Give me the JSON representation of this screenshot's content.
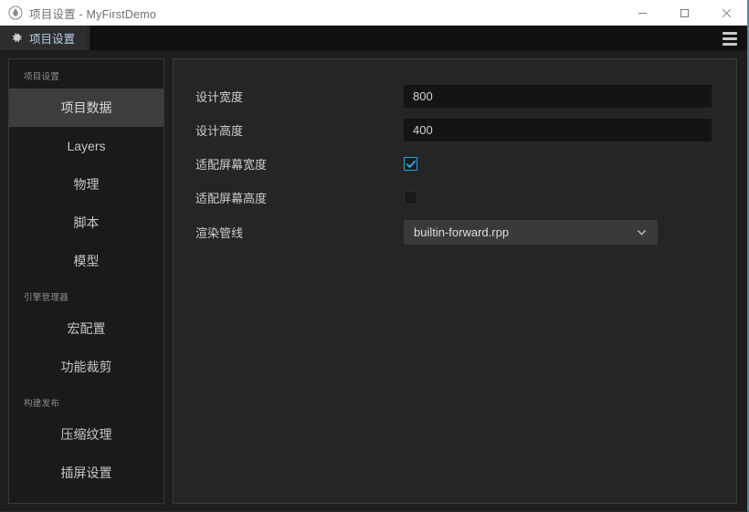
{
  "window": {
    "title": "项目设置 - MyFirstDemo",
    "app_icon": "droplet-logo-icon",
    "controls": {
      "minimize": "minimize-icon",
      "maximize": "maximize-icon",
      "close": "close-icon"
    }
  },
  "tabbar": {
    "tabs": [
      {
        "label": "项目设置",
        "icon": "gear-icon",
        "active": true
      }
    ],
    "menu_icon": "hamburger-menu-icon"
  },
  "sidebar": {
    "groups": [
      {
        "title": "项目设置",
        "items": [
          {
            "label": "项目数据",
            "active": true
          },
          {
            "label": "Layers",
            "active": false
          },
          {
            "label": "物理",
            "active": false
          },
          {
            "label": "脚本",
            "active": false
          },
          {
            "label": "模型",
            "active": false
          }
        ]
      },
      {
        "title": "引擎管理器",
        "items": [
          {
            "label": "宏配置",
            "active": false
          },
          {
            "label": "功能裁剪",
            "active": false
          }
        ]
      },
      {
        "title": "构建发布",
        "items": [
          {
            "label": "压缩纹理",
            "active": false
          },
          {
            "label": "插屏设置",
            "active": false
          }
        ]
      }
    ]
  },
  "main": {
    "fields": [
      {
        "type": "text",
        "label": "设计宽度",
        "value": "800",
        "placeholder": ""
      },
      {
        "type": "text",
        "label": "设计高度",
        "value": "400",
        "placeholder": ""
      },
      {
        "type": "checkbox",
        "label": "适配屏幕宽度",
        "checked": true
      },
      {
        "type": "checkbox",
        "label": "适配屏幕高度",
        "checked": false
      },
      {
        "type": "select",
        "label": "渲染管线",
        "value": "builtin-forward.rpp",
        "icon": "chevron-down-icon"
      }
    ]
  },
  "colors": {
    "accent": "#2ba4dd",
    "tab_text": "#b8cfe8",
    "window_border": "#5a7fb8",
    "sidebar_active_bg": "#3d3d3d",
    "panel_bg": "#252525",
    "input_bg": "#141414",
    "select_bg": "#3a3a3a"
  }
}
